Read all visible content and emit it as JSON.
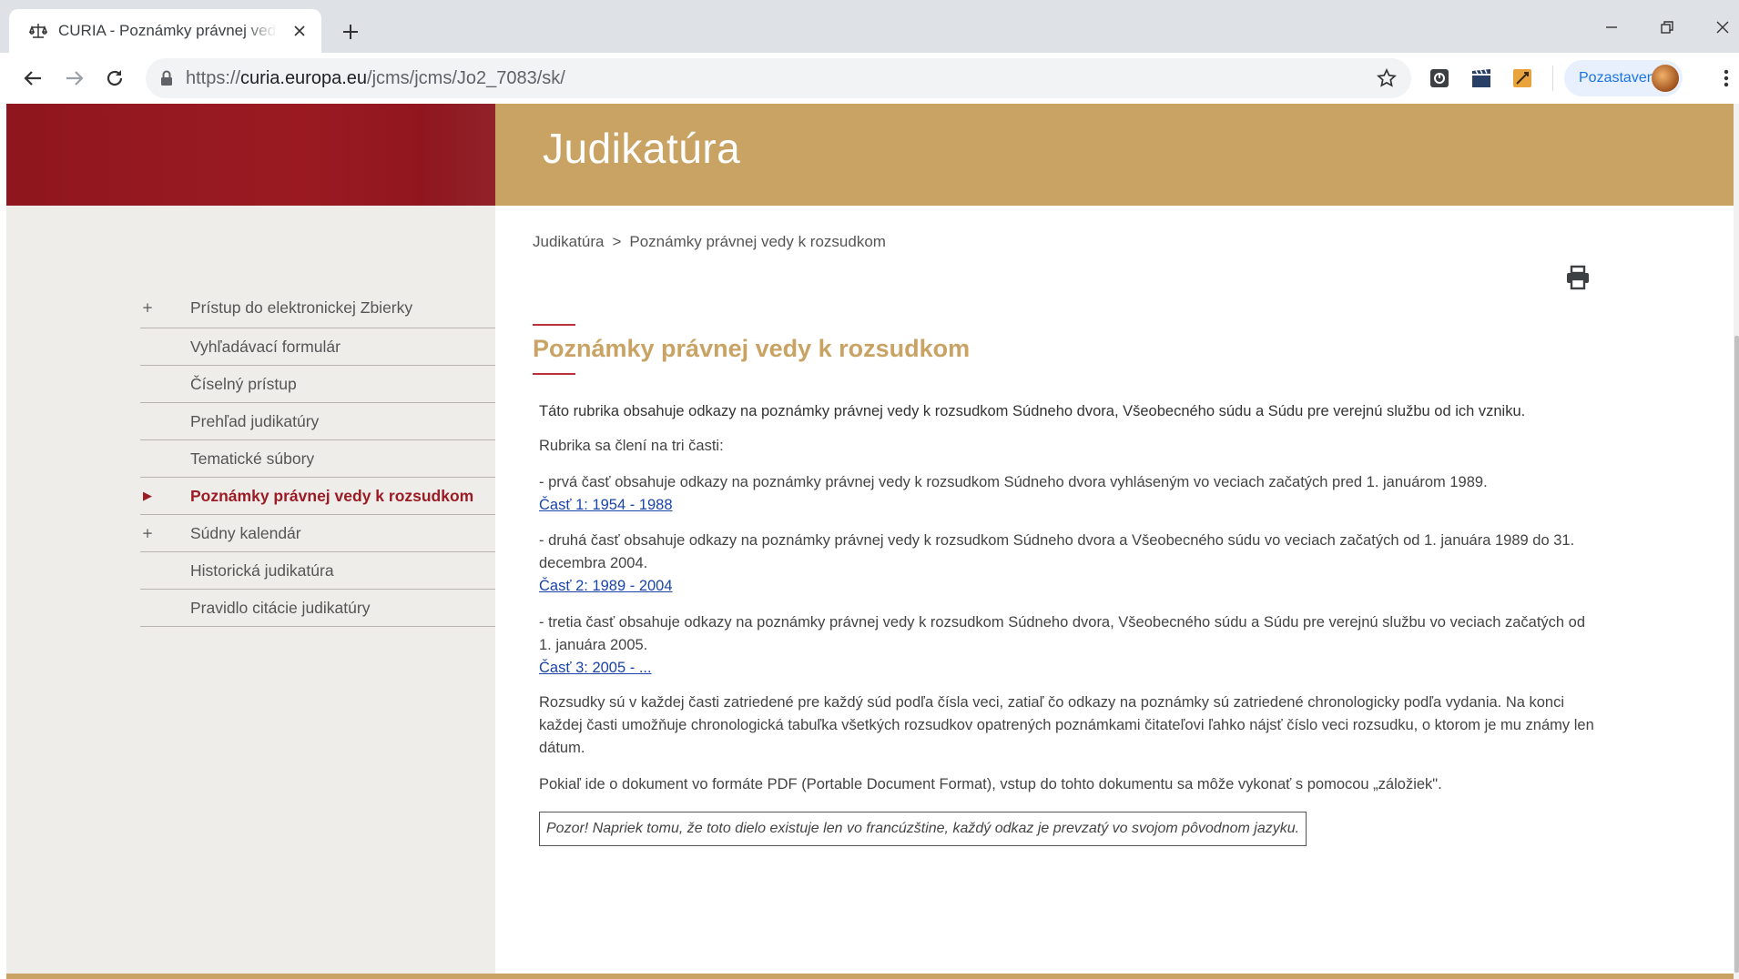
{
  "browser": {
    "tab_title": "CURIA - Poznámky právnej vedy k rozsudkom",
    "url_scheme": "https://",
    "url_host": "curia.europa.eu",
    "url_path": "/jcms/jcms/Jo2_7083/sk/",
    "profile_label": "Pozastavená"
  },
  "banner": {
    "title": "Judikatúra"
  },
  "sidebar": {
    "items": [
      {
        "marker": "+",
        "label": "Prístup do elektronickej Zbierky"
      },
      {
        "marker": "",
        "label": "Vyhľadávací formulár"
      },
      {
        "marker": "",
        "label": "Číselný prístup"
      },
      {
        "marker": "",
        "label": "Prehľad judikatúry"
      },
      {
        "marker": "",
        "label": "Tematické súbory"
      },
      {
        "marker": "▶",
        "label": "Poznámky právnej vedy k rozsudkom"
      },
      {
        "marker": "+",
        "label": "Súdny kalendár"
      },
      {
        "marker": "",
        "label": "Historická judikatúra"
      },
      {
        "marker": "",
        "label": "Pravidlo citácie judikatúry"
      }
    ]
  },
  "breadcrumb": {
    "root": "Judikatúra",
    "separator": ">",
    "current": "Poznámky právnej vedy k rozsudkom"
  },
  "main": {
    "heading": "Poznámky právnej vedy k rozsudkom",
    "intro": "Táto rubrika obsahuje odkazy na poznámky právnej vedy k rozsudkom Súdneho dvora, Všeobecného súdu a Súdu pre verejnú službu od ich vzniku.",
    "parts_intro": "Rubrika sa člení na tri časti:",
    "part1_text": "- prvá časť obsahuje odkazy na poznámky právnej vedy k rozsudkom Súdneho dvora vyhláseným vo veciach začatých pred 1. januárom 1989.",
    "part1_link": "Časť 1: 1954 - 1988",
    "part2_text": "- druhá časť obsahuje odkazy na poznámky právnej vedy k rozsudkom Súdneho dvora a Všeobecného súdu vo veciach začatých od 1. januára 1989 do 31. decembra 2004.",
    "part2_link": "Časť 2: 1989 - 2004",
    "part3_text": "- tretia časť obsahuje odkazy na poznámky právnej vedy k rozsudkom Súdneho dvora, Všeobecného súdu a Súdu pre verejnú službu vo veciach začatých od 1. januára 2005.",
    "part3_link": "Časť 3: 2005 - ...",
    "sorting": "Rozsudky sú v každej časti zatriedené pre každý súd podľa čísla veci, zatiaľ čo odkazy na poznámky sú zatriedené chronologicky podľa vydania. Na konci každej časti umožňuje chronologická tabuľka všetkých rozsudkov opatrených poznámkami čitateľovi ľahko nájsť číslo veci rozsudku, o ktorom je mu známy len dátum.",
    "pdf_note": "Pokiaľ ide o dokument vo formáte PDF (Portable Document Format), vstup do tohto dokumentu sa môže vykonať s pomocou „záložiek\".",
    "warning": "Pozor! Napriek tomu, že toto dielo existuje len vo francúzštine, každý odkaz je prevzatý vo svojom pôvodnom jazyku."
  },
  "colors": {
    "gold": "#c9a363",
    "red": "#9b1a22",
    "link": "#1a44a8"
  }
}
